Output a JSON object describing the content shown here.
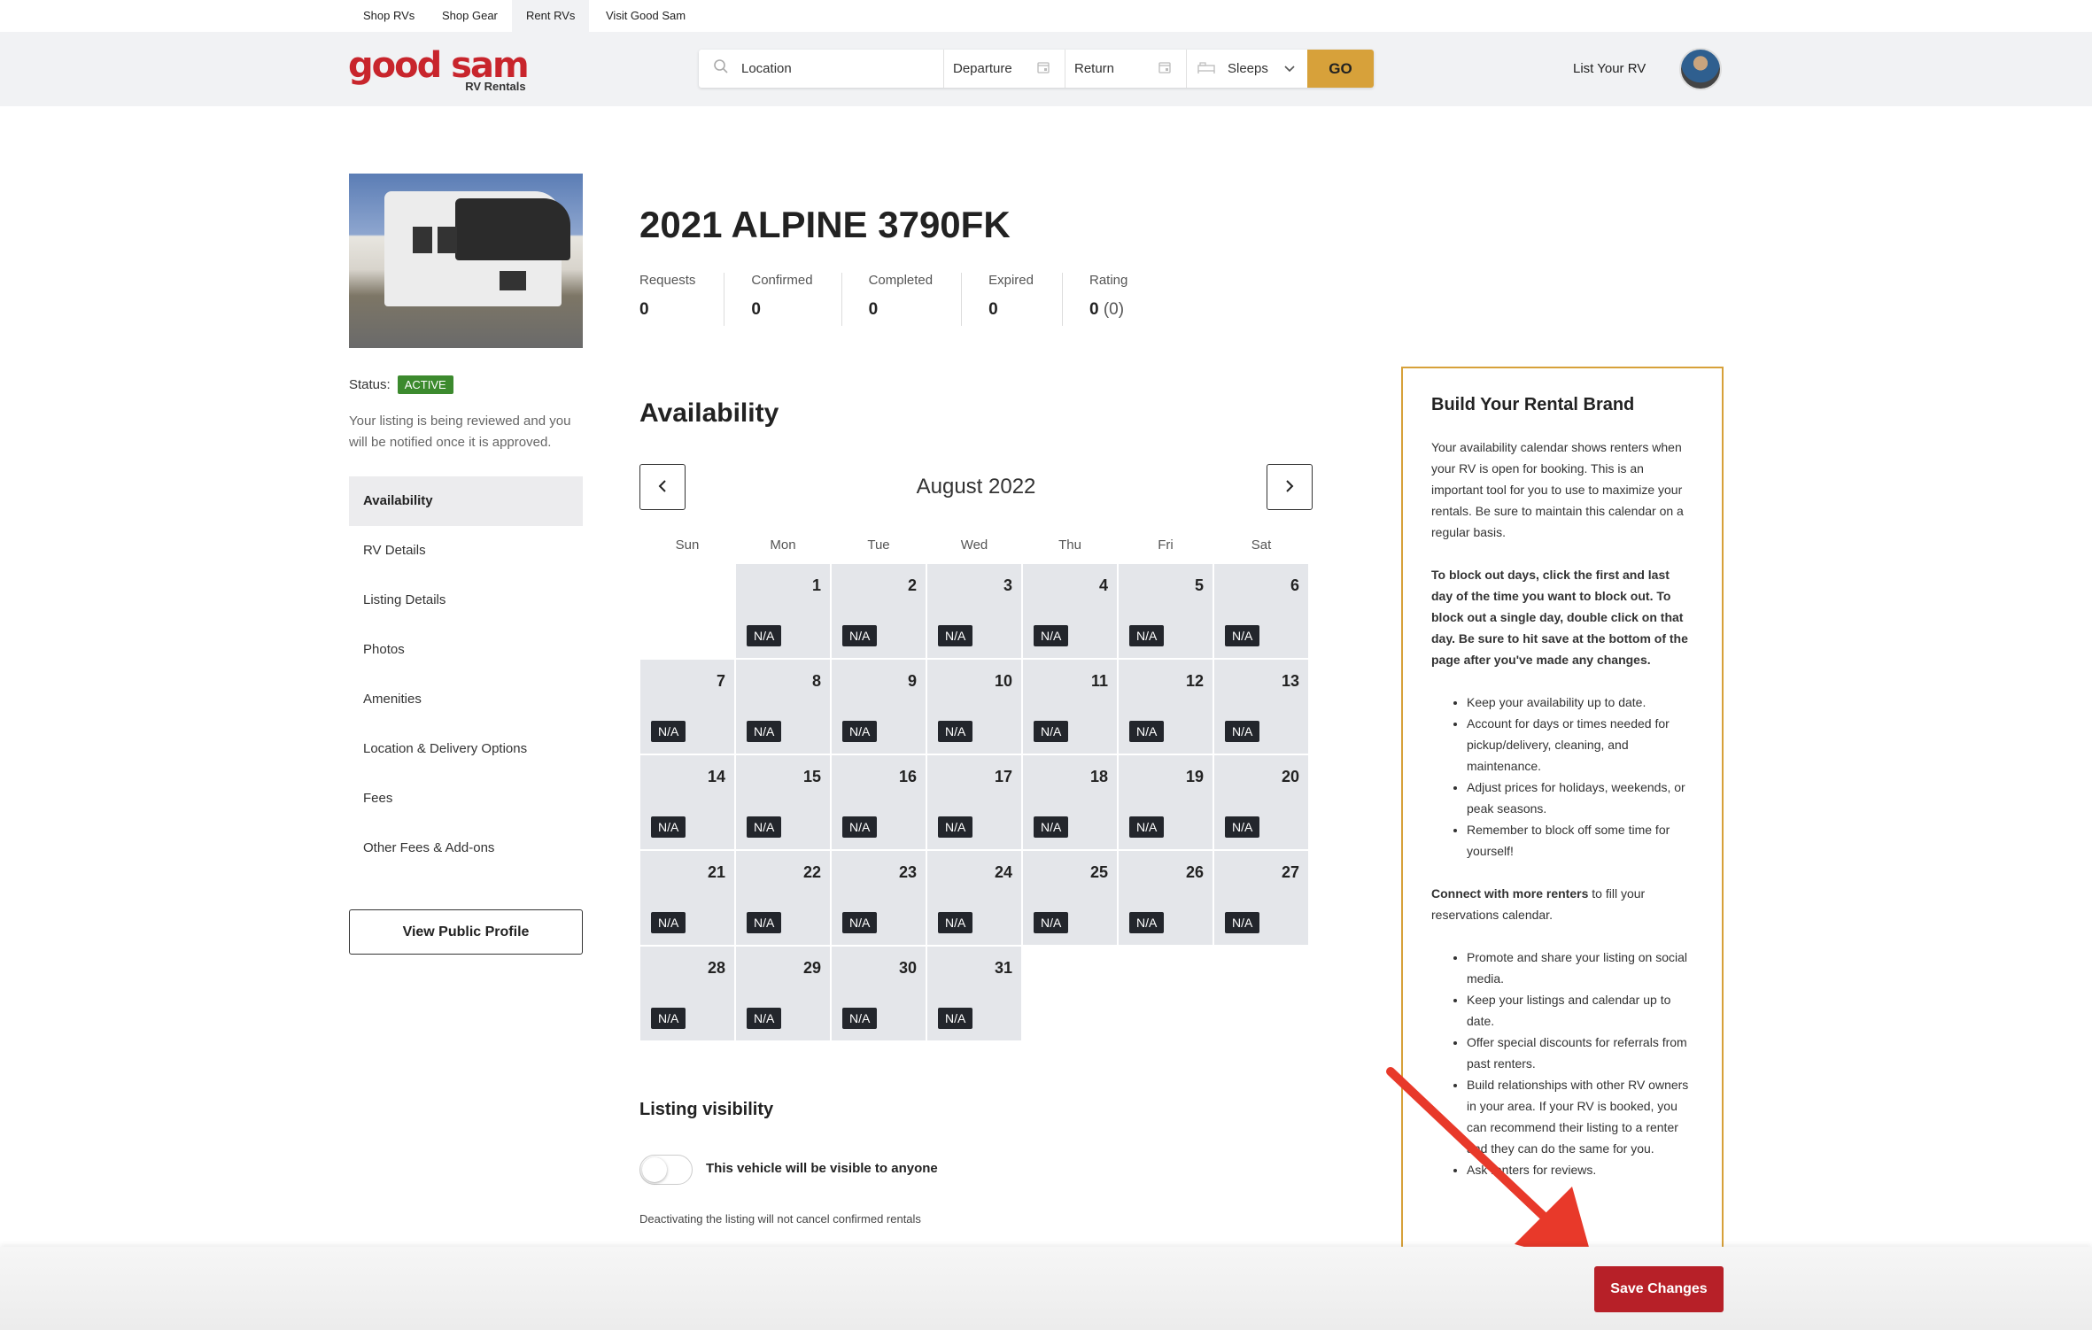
{
  "topnav": {
    "items": [
      "Shop RVs",
      "Shop Gear",
      "Rent RVs",
      "Visit Good Sam"
    ],
    "active": "Rent RVs"
  },
  "header": {
    "logo_text": "good sam",
    "logo_sub": "RV Rentals",
    "search": {
      "location_placeholder": "Location",
      "departure_label": "Departure",
      "return_label": "Return",
      "sleeps_label": "Sleeps",
      "go_label": "GO"
    },
    "list_rv_label": "List Your RV"
  },
  "sidebar": {
    "status_label": "Status:",
    "status_badge": "ACTIVE",
    "review_note": "Your listing is being reviewed and you will be notified once it is approved.",
    "items": [
      "Availability",
      "RV Details",
      "Listing Details",
      "Photos",
      "Amenities",
      "Location & Delivery Options",
      "Fees",
      "Other Fees & Add-ons"
    ],
    "view_profile_label": "View Public Profile"
  },
  "listing": {
    "title": "2021 ALPINE 3790FK",
    "stats": [
      {
        "label": "Requests",
        "value": "0"
      },
      {
        "label": "Confirmed",
        "value": "0"
      },
      {
        "label": "Completed",
        "value": "0"
      },
      {
        "label": "Expired",
        "value": "0"
      },
      {
        "label": "Rating",
        "value": "0",
        "extra": "(0)"
      }
    ]
  },
  "availability": {
    "heading": "Availability",
    "month": "August 2022",
    "weekdays": [
      "Sun",
      "Mon",
      "Tue",
      "Wed",
      "Thu",
      "Fri",
      "Sat"
    ],
    "first_weekday_index": 1,
    "days_in_month": 31,
    "day_status": "N/A"
  },
  "visibility": {
    "heading": "Listing visibility",
    "toggle_label": "This vehicle will be visible to anyone",
    "note": "Deactivating the listing will not cancel confirmed rentals"
  },
  "brand_panel": {
    "title": "Build Your Rental Brand",
    "intro": "Your availability calendar shows renters when your RV is open for booking.  This is an important tool for you to use to maximize your rentals.  Be sure to maintain this calendar on a regular basis.",
    "instructions": "To block out days, click the first and last day of the time you want to block out.  To block out a single day, double click on that day.  Be sure to hit save at the bottom of the page after you've made any changes.",
    "tips": [
      "Keep your availability up to date.",
      "Account for days or times needed for pickup/delivery, cleaning, and maintenance.",
      "Adjust prices for holidays, weekends, or peak seasons.",
      "Remember to block off some time for yourself!"
    ],
    "connect_bold": "Connect with more renters",
    "connect_rest": " to fill your reservations calendar.",
    "connect_tips": [
      "Promote and share your listing on social media.",
      "Keep your listings and calendar up to date.",
      "Offer special discounts for referrals from past renters.",
      "Build relationships with other RV owners in your area.  If your RV is booked, you can recommend their listing to a renter and they can do the same for you.",
      "Ask renters for reviews."
    ]
  },
  "footer": {
    "save_label": "Save Changes"
  },
  "colors": {
    "brand_red": "#c8252c",
    "go_gold": "#d7a13a",
    "save_red": "#b72028",
    "active_green": "#3c8a2e",
    "arrow_red": "#e8392a"
  }
}
